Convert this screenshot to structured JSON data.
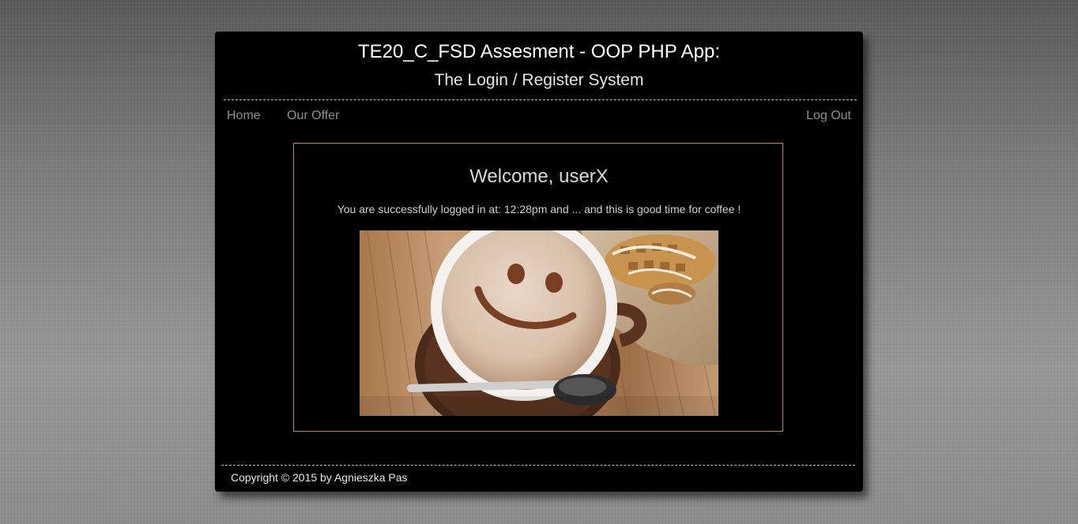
{
  "header": {
    "title": "TE20_C_FSD Assesment - OOP PHP App:",
    "subtitle": "The Login / Register System"
  },
  "nav": {
    "home": "Home",
    "offer": "Our Offer",
    "logout": "Log Out"
  },
  "main": {
    "welcome_prefix": "Welcome, ",
    "username": "userX",
    "login_message": "You are successfully logged in at: 12:28pm and ... and this is good time for coffee !",
    "photo_icon": "coffee-smiley-photo"
  },
  "footer": {
    "copyright": "Copyright © 2015 by Agnieszka Pas"
  },
  "colors": {
    "panel_background": "#000000",
    "content_border": "#c8864a",
    "nav_text": "#8f8f8f"
  }
}
